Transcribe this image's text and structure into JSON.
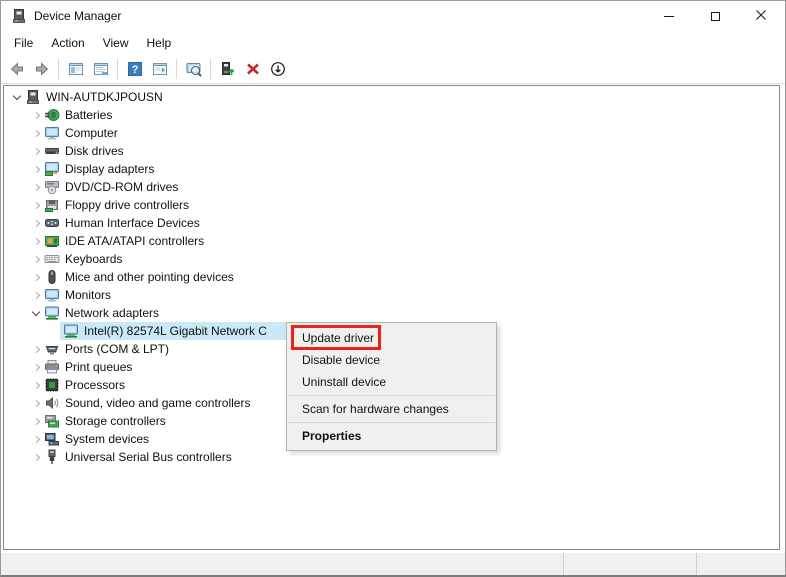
{
  "window": {
    "title": "Device Manager",
    "app_icon": "device-manager-icon",
    "controls": [
      "minimize",
      "maximize",
      "close"
    ]
  },
  "menu_bar": {
    "items": [
      "File",
      "Action",
      "View",
      "Help"
    ]
  },
  "toolbar": {
    "buttons": [
      {
        "icon": "back-icon"
      },
      {
        "icon": "forward-icon"
      },
      {
        "separator": true
      },
      {
        "icon": "console-tree-icon"
      },
      {
        "icon": "properties-icon"
      },
      {
        "separator": true
      },
      {
        "icon": "help-icon"
      },
      {
        "icon": "action-pane-icon"
      },
      {
        "separator": true
      },
      {
        "icon": "scan-icon"
      },
      {
        "separator": true
      },
      {
        "icon": "update-driver-icon"
      },
      {
        "icon": "uninstall-icon"
      },
      {
        "icon": "disable-icon"
      }
    ]
  },
  "tree": {
    "rows": [
      {
        "level": 0,
        "icon": "computer-root",
        "label": "WIN-AUTDKJPOUSN",
        "state": "expanded"
      },
      {
        "level": 1,
        "icon": "battery",
        "label": "Batteries",
        "state": "collapsed"
      },
      {
        "level": 1,
        "icon": "monitor",
        "label": "Computer",
        "state": "collapsed"
      },
      {
        "level": 1,
        "icon": "disk",
        "label": "Disk drives",
        "state": "collapsed"
      },
      {
        "level": 1,
        "icon": "display",
        "label": "Display adapters",
        "state": "collapsed"
      },
      {
        "level": 1,
        "icon": "dvd",
        "label": "DVD/CD-ROM drives",
        "state": "collapsed"
      },
      {
        "level": 1,
        "icon": "floppy",
        "label": "Floppy drive controllers",
        "state": "collapsed"
      },
      {
        "level": 1,
        "icon": "hid",
        "label": "Human Interface Devices",
        "state": "collapsed"
      },
      {
        "level": 1,
        "icon": "ide",
        "label": "IDE ATA/ATAPI controllers",
        "state": "collapsed"
      },
      {
        "level": 1,
        "icon": "keyboard",
        "label": "Keyboards",
        "state": "collapsed"
      },
      {
        "level": 1,
        "icon": "mouse",
        "label": "Mice and other pointing devices",
        "state": "collapsed"
      },
      {
        "level": 1,
        "icon": "monitor",
        "label": "Monitors",
        "state": "collapsed"
      },
      {
        "level": 1,
        "icon": "network",
        "label": "Network adapters",
        "state": "expanded"
      },
      {
        "level": 2,
        "icon": "network",
        "label": "Intel(R) 82574L Gigabit Network C",
        "state": "leaf",
        "selected": true
      },
      {
        "level": 1,
        "icon": "ports",
        "label": "Ports (COM & LPT)",
        "state": "collapsed"
      },
      {
        "level": 1,
        "icon": "printer",
        "label": "Print queues",
        "state": "collapsed"
      },
      {
        "level": 1,
        "icon": "processor",
        "label": "Processors",
        "state": "collapsed"
      },
      {
        "level": 1,
        "icon": "sound",
        "label": "Sound, video and game controllers",
        "state": "collapsed"
      },
      {
        "level": 1,
        "icon": "storage",
        "label": "Storage controllers",
        "state": "collapsed"
      },
      {
        "level": 1,
        "icon": "system",
        "label": "System devices",
        "state": "collapsed"
      },
      {
        "level": 1,
        "icon": "usb",
        "label": "Universal Serial Bus controllers",
        "state": "collapsed"
      }
    ]
  },
  "context_menu": {
    "items": [
      {
        "label": "Update driver",
        "annotated": true
      },
      {
        "label": "Disable device"
      },
      {
        "label": "Uninstall device"
      },
      {
        "separator": true
      },
      {
        "label": "Scan for hardware changes"
      },
      {
        "separator": true
      },
      {
        "label": "Properties",
        "bold": true
      }
    ]
  },
  "annotation": {
    "shape": "rectangle",
    "color": "#e8231a",
    "target": "Update driver"
  },
  "status_bar": {
    "cells": [
      "",
      "",
      ""
    ]
  },
  "colors": {
    "selection": "#cbe8f6",
    "menu_background": "#f0f0f0",
    "statusbar_background": "#f0f0f0",
    "annotation_red": "#e8231a"
  }
}
